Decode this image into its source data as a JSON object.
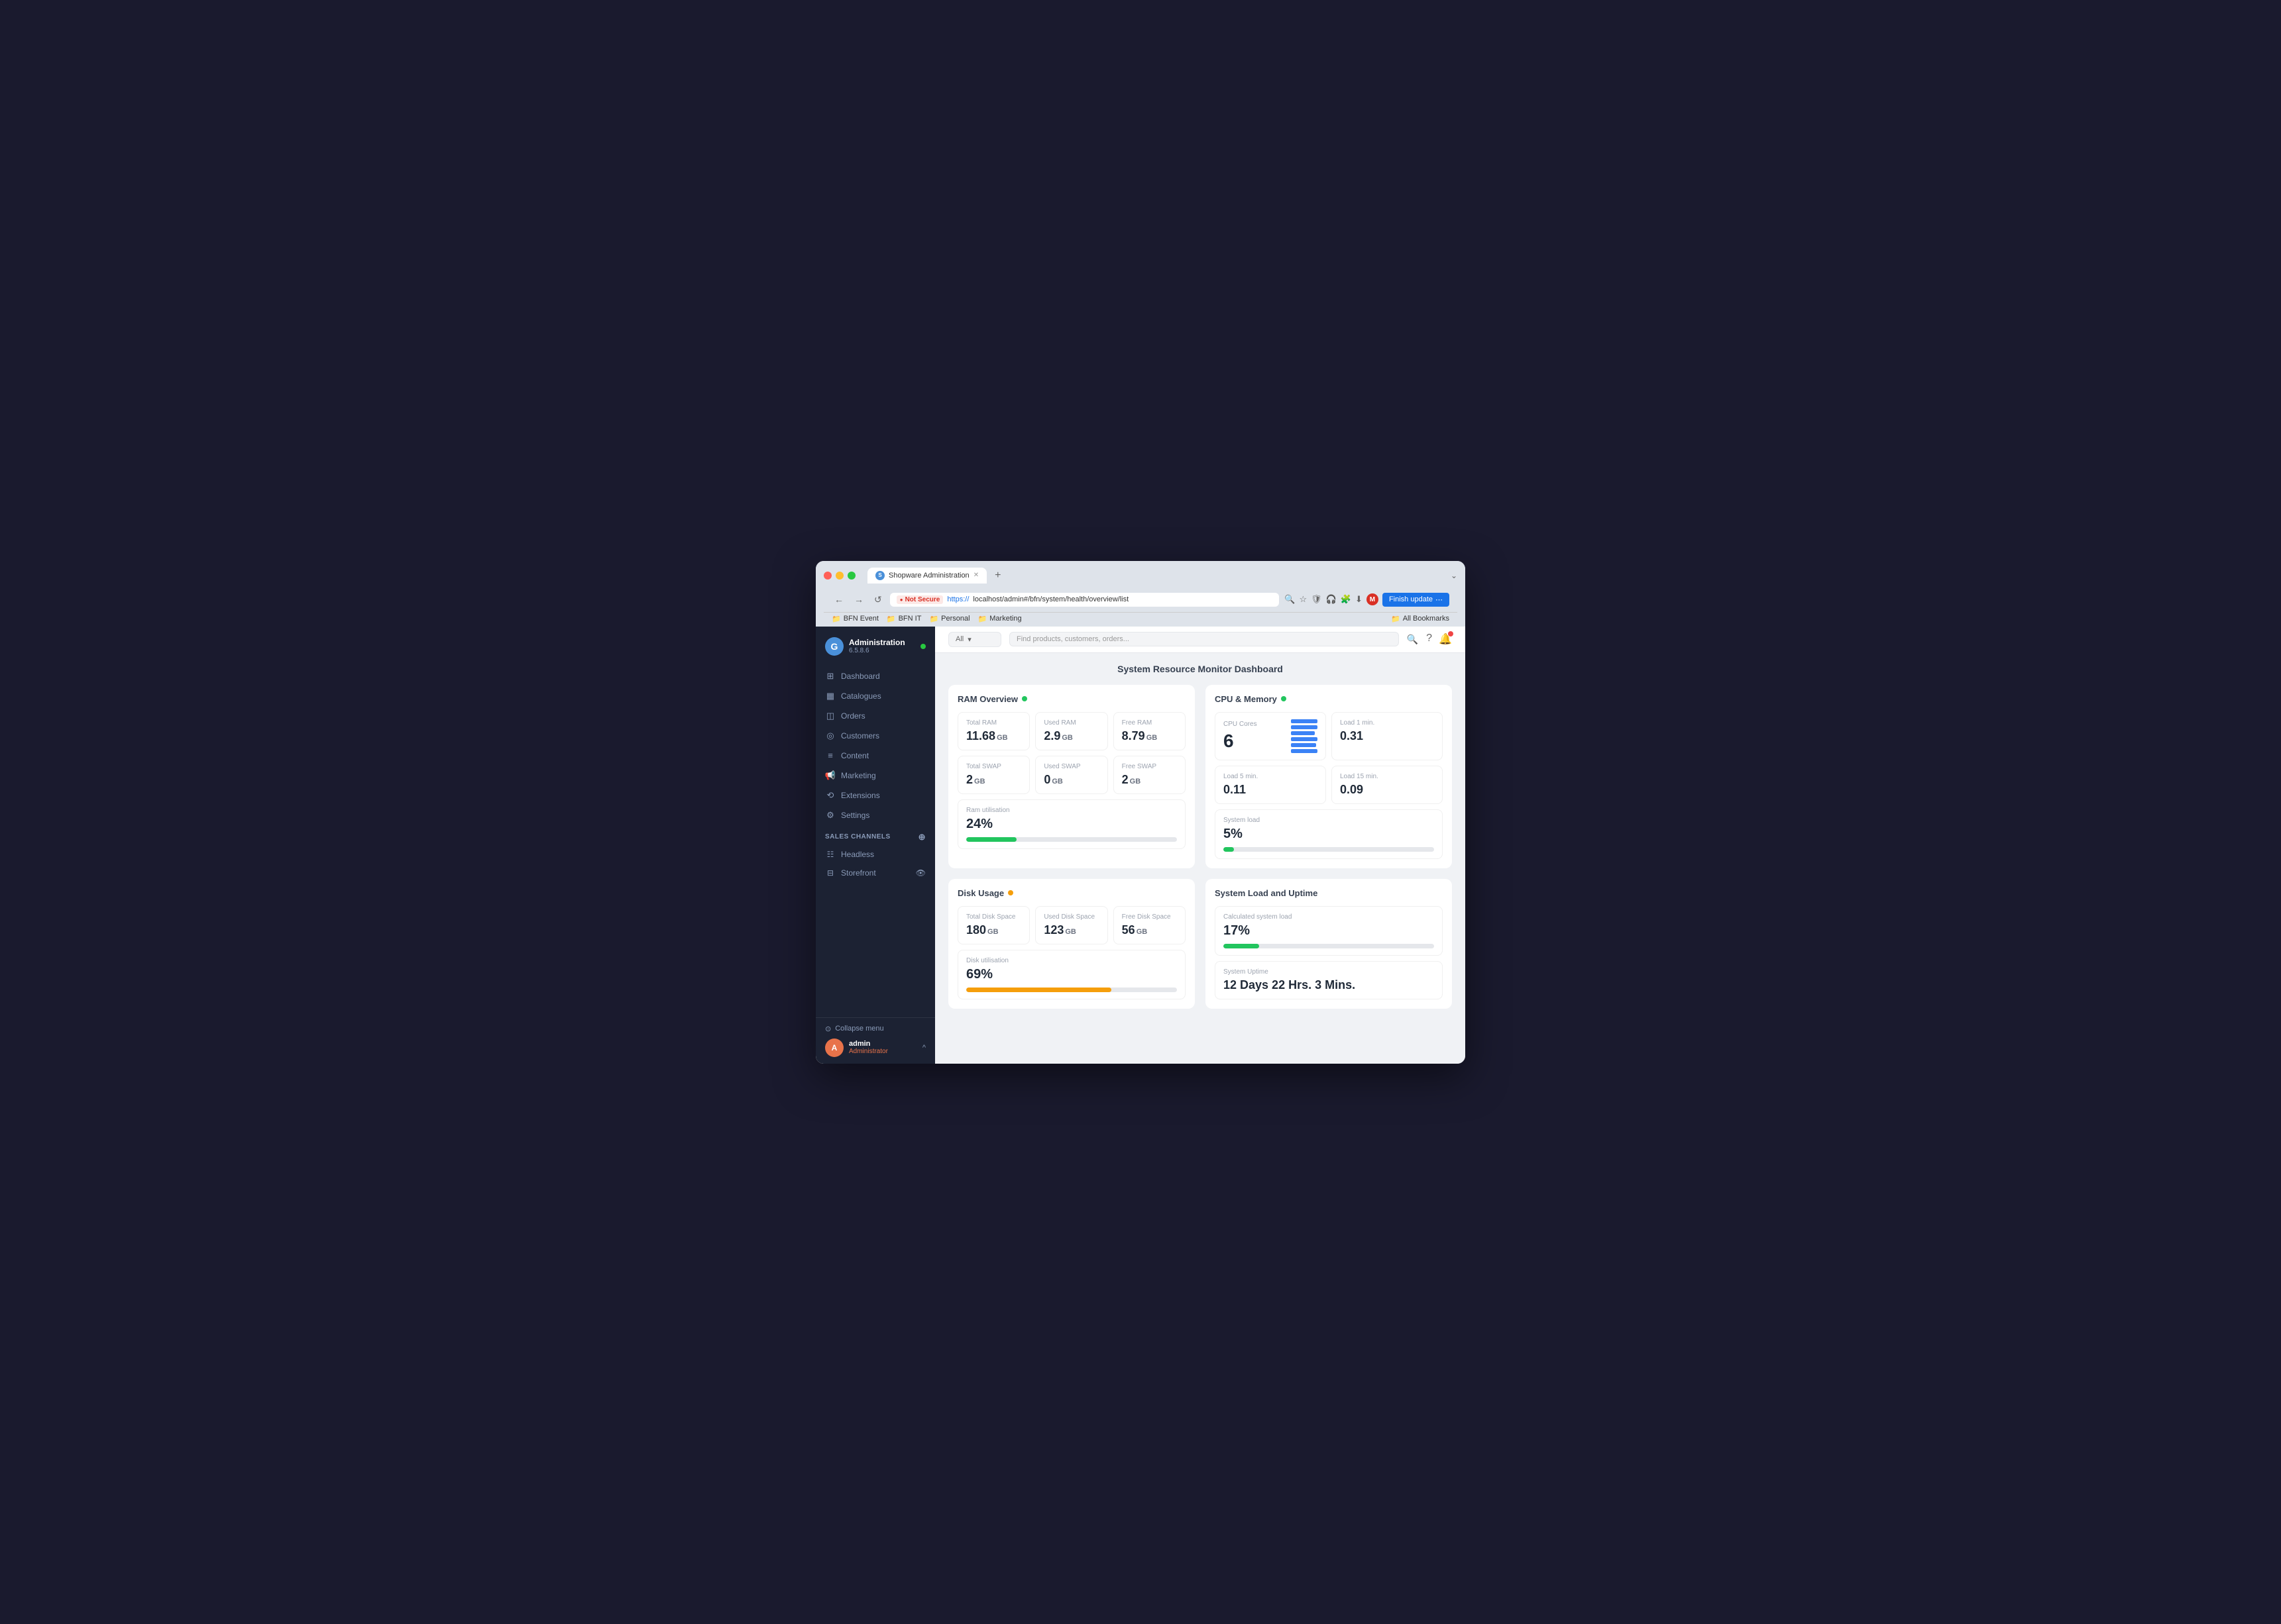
{
  "browser": {
    "tab_title": "Shopware Administration",
    "url_not_secure": "Not Secure",
    "url": "https://localhost/admin#/bfn/system/health/overview/list",
    "url_https": "https://",
    "url_path": "localhost/admin#/bfn/system/health/overview/list",
    "new_tab": "+",
    "nav_back": "←",
    "nav_forward": "→",
    "nav_reload": "↺",
    "finish_update": "Finish update",
    "bookmarks": [
      {
        "label": "BFN Event",
        "icon": "📁"
      },
      {
        "label": "BFN IT",
        "icon": "📁"
      },
      {
        "label": "Personal",
        "icon": "📁"
      },
      {
        "label": "Marketing",
        "icon": "📁"
      }
    ],
    "all_bookmarks": "All Bookmarks"
  },
  "sidebar": {
    "brand": "Administration",
    "version": "6.5.8.6",
    "nav_items": [
      {
        "label": "Dashboard",
        "icon": "⊞"
      },
      {
        "label": "Catalogues",
        "icon": "▦"
      },
      {
        "label": "Orders",
        "icon": "◫"
      },
      {
        "label": "Customers",
        "icon": "◎"
      },
      {
        "label": "Content",
        "icon": "≡"
      },
      {
        "label": "Marketing",
        "icon": "⚑"
      },
      {
        "label": "Extensions",
        "icon": "⟲"
      },
      {
        "label": "Settings",
        "icon": "⚙"
      }
    ],
    "sales_channels_title": "Sales Channels",
    "sales_channels": [
      {
        "label": "Headless",
        "icon": "☷"
      },
      {
        "label": "Storefront",
        "icon": "⊟"
      }
    ],
    "collapse_menu": "Collapse menu",
    "user_name": "admin",
    "user_role": "Administrator",
    "user_initial": "A"
  },
  "topbar": {
    "search_filter": "All",
    "search_placeholder": "Find products, customers, orders..."
  },
  "dashboard": {
    "title": "System Resource Monitor Dashboard",
    "ram_overview": {
      "title": "RAM Overview",
      "status": "green",
      "total_ram_label": "Total RAM",
      "total_ram_value": "11.68",
      "total_ram_unit": "GB",
      "used_ram_label": "Used RAM",
      "used_ram_value": "2.9",
      "used_ram_unit": "GB",
      "free_ram_label": "Free RAM",
      "free_ram_value": "8.79",
      "free_ram_unit": "GB",
      "total_swap_label": "Total SWAP",
      "total_swap_value": "2",
      "total_swap_unit": "GB",
      "used_swap_label": "Used SWAP",
      "used_swap_value": "0",
      "used_swap_unit": "GB",
      "free_swap_label": "Free SWAP",
      "free_swap_value": "2",
      "free_swap_unit": "GB",
      "utilization_label": "Ram utilisation",
      "utilization_value": "24%",
      "utilization_percent": 24
    },
    "cpu_memory": {
      "title": "CPU & Memory",
      "status": "green",
      "cpu_cores_label": "CPU Cores",
      "cpu_cores_value": "6",
      "load1_label": "Load 1 min.",
      "load1_value": "0.31",
      "load5_label": "Load 5 min.",
      "load5_value": "0.11",
      "load15_label": "Load 15 min.",
      "load15_value": "0.09",
      "system_load_label": "System load",
      "system_load_value": "5%",
      "system_load_percent": 5
    },
    "disk_usage": {
      "title": "Disk Usage",
      "status": "orange",
      "total_disk_label": "Total Disk Space",
      "total_disk_value": "180",
      "total_disk_unit": "GB",
      "used_disk_label": "Used Disk Space",
      "used_disk_value": "123",
      "used_disk_unit": "GB",
      "free_disk_label": "Free Disk Space",
      "free_disk_value": "56",
      "free_disk_unit": "GB",
      "utilization_label": "Disk utilisation",
      "utilization_value": "69%",
      "utilization_percent": 69
    },
    "system_load_uptime": {
      "title": "System Load and Uptime",
      "calc_load_label": "Calculated system load",
      "calc_load_value": "17%",
      "calc_load_percent": 17,
      "uptime_label": "System Uptime",
      "uptime_value": "12 Days 22 Hrs. 3 Mins."
    }
  }
}
